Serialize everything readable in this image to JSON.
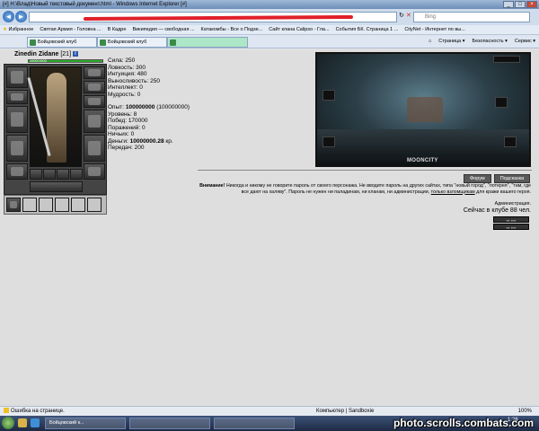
{
  "window": {
    "title": "[#] H:\\Влад\\Новый текстовый документ.html - Windows Internet Explorer [#]"
  },
  "addressbar": {
    "url": "",
    "search_placeholder": "Bing"
  },
  "favorites": {
    "label": "Избранное",
    "items": [
      "Святая Армия - Головна ...",
      "В Кадре",
      "Википедия — свободная ...",
      "Катакомбы - Все о Подзе...",
      "Сайт клана Calipso - Гла...",
      "События БК. Страница 1 ...",
      "CityNet - Интернет по вы..."
    ]
  },
  "tabs": [
    {
      "label": "Бойцовский клуб"
    },
    {
      "label": "Бойцовский клуб"
    },
    {
      "label": ""
    }
  ],
  "commandbar": {
    "page": "Страница ▾",
    "safety": "Безопасность ▾",
    "tools": "Сервис ▾"
  },
  "character": {
    "name": "Zinedin Zidane",
    "level": "[21]",
    "hp_text": "1500/1500",
    "hp_fraction": 1.0,
    "stats": [
      "Сила: 250",
      "Ловкость: 300",
      "Интуиция: 480",
      "Выносливость: 250",
      "Интеллект: 0",
      "Мудрость: 0"
    ],
    "experience_label": "Опыт: ",
    "experience_value": "100000000",
    "experience_next": "(100000000)",
    "progress": [
      "Уровень: 8",
      "Побед: 170000",
      "Поражений: 0",
      "Ничьих: 0"
    ],
    "money_label": "Деньги: ",
    "money_value": "10000000.28",
    "money_unit": " кр.",
    "transfers": "Передач: 200"
  },
  "scene": {
    "label": "MOONCITY"
  },
  "buttons": {
    "forum": "Форум",
    "help": "Подсказка"
  },
  "warning": {
    "bold": "Внимание!",
    "text1": " Никогда и никому не говорите пароль от своего персонажа. Не вводите пароль на других сайтах, типа \"новый город\", \"лотерея\", \"там, где все дают на халяву\". Пароль не нужен ни паладинам, ни кланам, ни администрации, ",
    "underlined": "только взломщикам",
    "text2": " для кражи вашего героя.",
    "signature": "Администрация."
  },
  "online": "Сейчас в клубе 88 чел.",
  "statusbar": {
    "error": "Ошибка на странице.",
    "zone": "Компьютер | Sandboxie",
    "zoom": "100%"
  },
  "taskbar": {
    "tasks": [
      "Бойцовский к...",
      "",
      ""
    ],
    "clock": "1:26"
  },
  "watermark": "photo.scrolls.combats.com"
}
